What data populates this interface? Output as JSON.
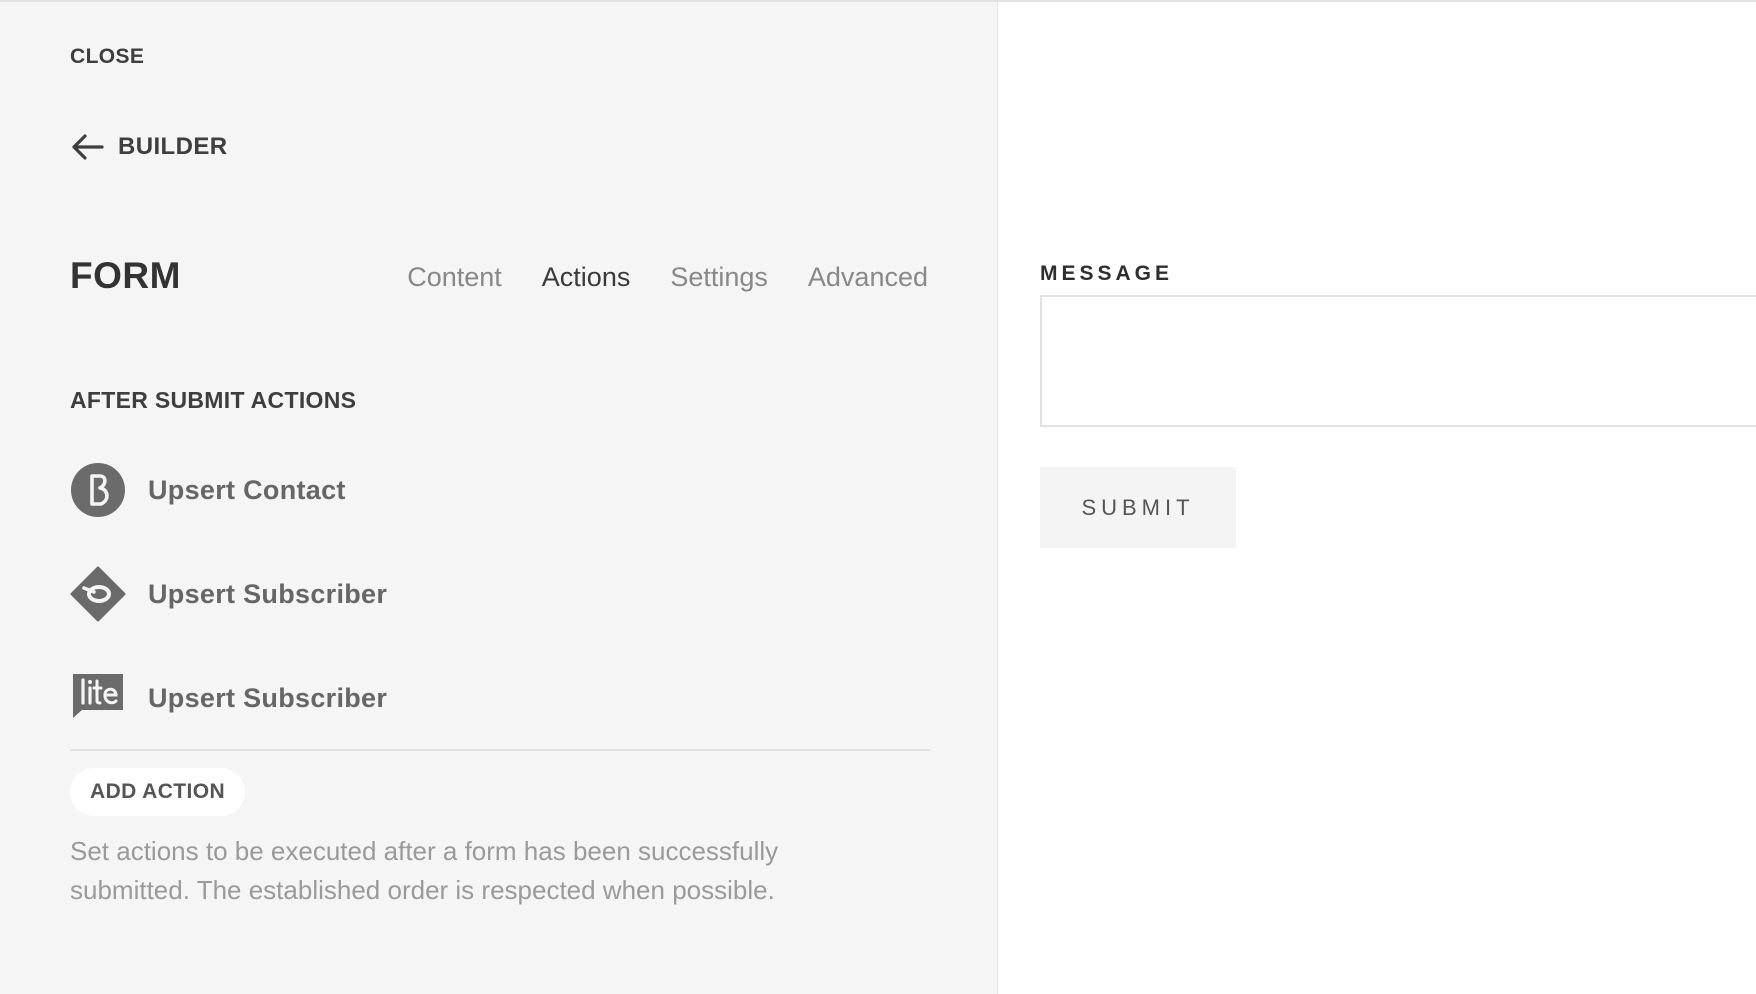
{
  "panel": {
    "close_label": "CLOSE",
    "back_label": "BUILDER",
    "title": "FORM",
    "tabs": [
      {
        "label": "Content",
        "active": false
      },
      {
        "label": "Actions",
        "active": true
      },
      {
        "label": "Settings",
        "active": false
      },
      {
        "label": "Advanced",
        "active": false
      }
    ],
    "section_heading": "AFTER SUBMIT ACTIONS",
    "actions": [
      {
        "label": "Upsert Contact",
        "icon": "brevo-b-icon"
      },
      {
        "label": "Upsert Subscriber",
        "icon": "mailpoet-envelope-icon"
      },
      {
        "label": "Upsert Subscriber",
        "icon": "mailerlite-lite-icon"
      }
    ],
    "add_action_label": "ADD ACTION",
    "help_text": "Set actions to be executed after a form has been successfully submitted. The established order is respected when possible."
  },
  "preview": {
    "message_label": "MESSAGE",
    "message_value": "",
    "submit_label": "SUBMIT"
  },
  "colors": {
    "panel_bg": "#f5f5f5",
    "icon_gray": "#6b6b6b",
    "active_tab": "#3a3a3a",
    "inactive_tab": "#888888"
  }
}
